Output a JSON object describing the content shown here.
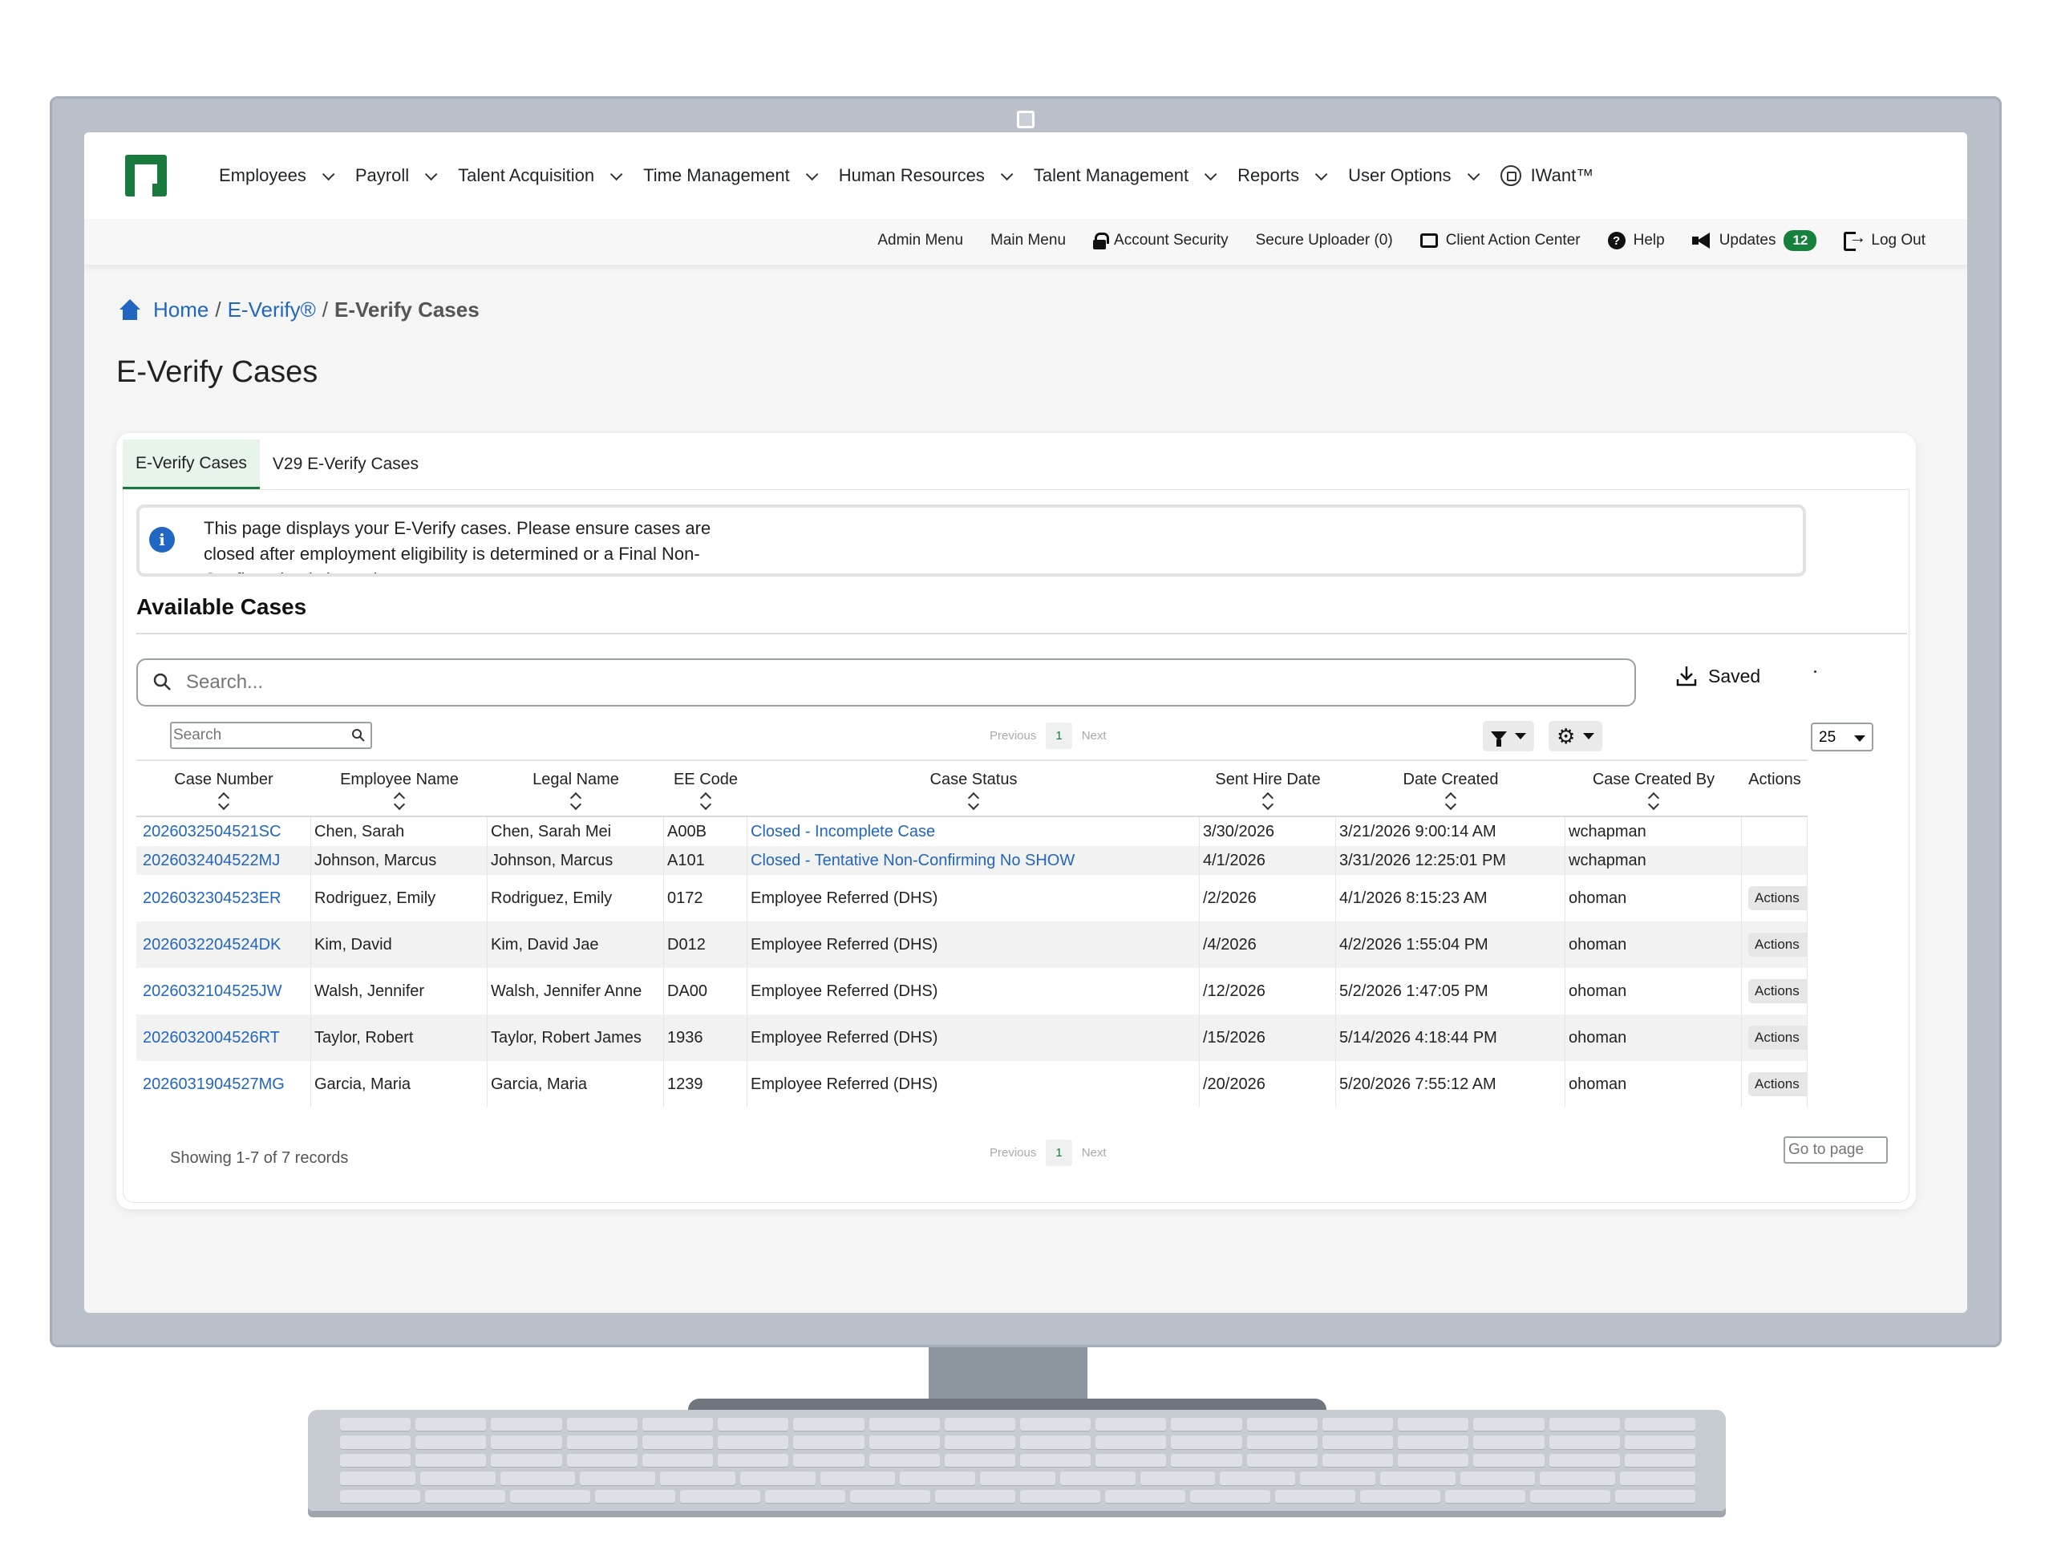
{
  "nav": {
    "items": [
      {
        "label": "Employees"
      },
      {
        "label": "Payroll"
      },
      {
        "label": "Talent Acquisition"
      },
      {
        "label": "Time Management"
      },
      {
        "label": "Human Resources"
      },
      {
        "label": "Talent Management"
      },
      {
        "label": "Reports"
      },
      {
        "label": "User Options"
      }
    ],
    "iwant": "IWant™"
  },
  "subnav": {
    "admin_menu": "Admin Menu",
    "main_menu": "Main Menu",
    "account_security": "Account Security",
    "secure_uploader": "Secure Uploader (0)",
    "client_action_center": "Client Action Center",
    "help": "Help",
    "updates": "Updates",
    "updates_count": "12",
    "log_out": "Log Out"
  },
  "breadcrumb": {
    "home": "Home",
    "sep": "/",
    "everify": "E-Verify®",
    "current": "E-Verify Cases"
  },
  "page_title": "E-Verify Cases",
  "tabs": [
    {
      "label": "E-Verify Cases",
      "active": true
    },
    {
      "label": "V29 E-Verify Cases",
      "active": false
    }
  ],
  "info_text": "This page displays your E-Verify cases. Please ensure cases are closed after employment eligibility is determined or a Final Non-Confirmation is issued.",
  "section_title": "Available Cases",
  "search": {
    "placeholder": "Search..."
  },
  "saved_label": "Saved",
  "table_search": {
    "placeholder": "Search"
  },
  "pager": {
    "previous": "Previous",
    "page": "1",
    "next": "Next"
  },
  "page_size": "25",
  "columns": [
    "Case Number",
    "Employee Name",
    "Legal Name",
    "EE Code",
    "Case Status",
    "Sent Hire Date",
    "Date Created",
    "Case Created By",
    "Actions"
  ],
  "rows": [
    {
      "case": "2026032504521SC",
      "emp": "Chen, Sarah",
      "legal": "Chen, Sarah Mei",
      "code": "A00B",
      "status": "Closed - Incomplete Case",
      "status_link": true,
      "hire": "3/30/2026",
      "created": "3/21/2026 9:00:14 AM",
      "by": "wchapman",
      "action": ""
    },
    {
      "case": "2026032404522MJ",
      "emp": "Johnson, Marcus",
      "legal": "Johnson, Marcus",
      "code": "A101",
      "status": "Closed - Tentative Non-Confirming No SHOW",
      "status_link": true,
      "hire": "4/1/2026",
      "created": "3/31/2026 12:25:01 PM",
      "by": "wchapman",
      "action": ""
    },
    {
      "case": "2026032304523ER",
      "emp": "Rodriguez, Emily",
      "legal": "Rodriguez, Emily",
      "code": "0172",
      "status": "Employee Referred (DHS)",
      "status_link": false,
      "hire": "/2/2026",
      "created": "4/1/2026 8:15:23 AM",
      "by": "ohoman",
      "action": "Actions"
    },
    {
      "case": "2026032204524DK",
      "emp": "Kim, David",
      "legal": "Kim, David Jae",
      "code": "D012",
      "status": "Employee Referred (DHS)",
      "status_link": false,
      "hire": "/4/2026",
      "created": "4/2/2026 1:55:04 PM",
      "by": "ohoman",
      "action": "Actions"
    },
    {
      "case": "2026032104525JW",
      "emp": "Walsh, Jennifer",
      "legal": "Walsh, Jennifer Anne",
      "code": "DA00",
      "status": "Employee Referred (DHS)",
      "status_link": false,
      "hire": "/12/2026",
      "created": "5/2/2026 1:47:05 PM",
      "by": "ohoman",
      "action": "Actions"
    },
    {
      "case": "2026032004526RT",
      "emp": "Taylor, Robert",
      "legal": "Taylor, Robert James",
      "code": "1936",
      "status": "Employee Referred (DHS)",
      "status_link": false,
      "hire": "/15/2026",
      "created": "5/14/2026 4:18:44 PM",
      "by": "ohoman",
      "action": "Actions"
    },
    {
      "case": "2026031904527MG",
      "emp": "Garcia, Maria",
      "legal": "Garcia, Maria",
      "code": "1239",
      "status": "Employee Referred (DHS)",
      "status_link": false,
      "hire": "/20/2026",
      "created": "5/20/2026 7:55:12 AM",
      "by": "ohoman",
      "action": "Actions"
    }
  ],
  "footer": {
    "showing": "Showing 1-7 of 7 records",
    "goto_placeholder": "Go to page"
  },
  "colors": {
    "brand_green": "#1a7a3e",
    "link_blue": "#2166c0"
  }
}
